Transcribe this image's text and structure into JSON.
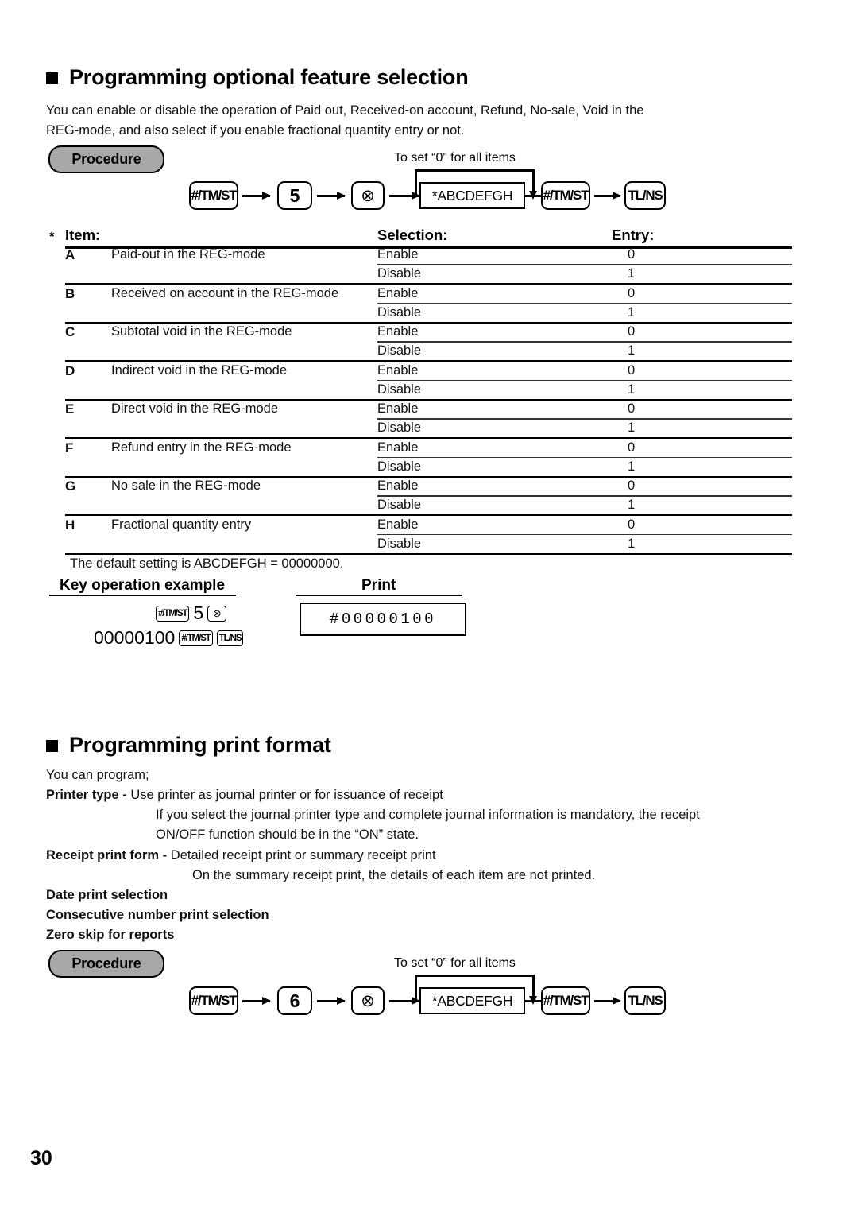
{
  "page": {
    "number": "30"
  },
  "section1": {
    "heading": "Programming optional feature selection",
    "intro_line1": "You can enable or disable the operation of Paid out, Received-on account, Refund, No-sale, Void in the",
    "intro_line2": "REG-mode, and also select if you enable fractional quantity entry or not.",
    "procedure_label": "Procedure",
    "flow": {
      "caption": "To set “0” for all items",
      "key1": "#/TM/ST",
      "key2": "5",
      "key3": "⊗",
      "box": "*ABCDEFGH",
      "key4": "#/TM/ST",
      "key5": "TL/NS"
    },
    "table": {
      "star": "*",
      "header_item": "Item:",
      "header_selection": "Selection:",
      "header_entry": "Entry:",
      "rows": [
        {
          "letter": "A",
          "item": "Paid-out in the REG-mode",
          "options": [
            {
              "selection": "Enable",
              "entry": "0"
            },
            {
              "selection": "Disable",
              "entry": "1"
            }
          ]
        },
        {
          "letter": "B",
          "item": "Received on account in the REG-mode",
          "options": [
            {
              "selection": "Enable",
              "entry": "0"
            },
            {
              "selection": "Disable",
              "entry": "1"
            }
          ]
        },
        {
          "letter": "C",
          "item": "Subtotal void in the REG-mode",
          "options": [
            {
              "selection": "Enable",
              "entry": "0"
            },
            {
              "selection": "Disable",
              "entry": "1"
            }
          ]
        },
        {
          "letter": "D",
          "item": "Indirect void in the REG-mode",
          "options": [
            {
              "selection": "Enable",
              "entry": "0"
            },
            {
              "selection": "Disable",
              "entry": "1"
            }
          ]
        },
        {
          "letter": "E",
          "item": "Direct void in the REG-mode",
          "options": [
            {
              "selection": "Enable",
              "entry": "0"
            },
            {
              "selection": "Disable",
              "entry": "1"
            }
          ]
        },
        {
          "letter": "F",
          "item": "Refund entry in the REG-mode",
          "options": [
            {
              "selection": "Enable",
              "entry": "0"
            },
            {
              "selection": "Disable",
              "entry": "1"
            }
          ]
        },
        {
          "letter": "G",
          "item": "No sale in the REG-mode",
          "options": [
            {
              "selection": "Enable",
              "entry": "0"
            },
            {
              "selection": "Disable",
              "entry": "1"
            }
          ]
        },
        {
          "letter": "H",
          "item": "Fractional quantity entry",
          "options": [
            {
              "selection": "Enable",
              "entry": "0"
            },
            {
              "selection": "Disable",
              "entry": "1"
            }
          ]
        }
      ]
    },
    "default_note": "The default setting is ABCDEFGH = 00000000.",
    "example": {
      "heading_keyop": "Key operation example",
      "heading_print": "Print",
      "line1_key1": "#/TM/ST",
      "line1_num": "5",
      "line1_key2": "⊗",
      "line2_num": "00000100",
      "line2_key1": "#/TM/ST",
      "line2_key2": "TL/NS",
      "print_value": "#00000100"
    }
  },
  "section2": {
    "heading": "Programming print format",
    "intro": "You can program;",
    "printer_type_label": "Printer type -",
    "printer_type_text": "Use printer as journal printer or for issuance of receipt",
    "printer_type_note1": "If you select the journal printer type and complete journal information is mandatory, the receipt",
    "printer_type_note2": "ON/OFF function should be in the “ON” state.",
    "receipt_form_label": "Receipt print form -",
    "receipt_form_text": "Detailed receipt print or summary receipt print",
    "receipt_form_note": "On the summary receipt print, the details of each item are not printed.",
    "bold_item1": "Date print selection",
    "bold_item2": "Consecutive number print selection",
    "bold_item3": "Zero skip for reports",
    "procedure_label": "Procedure",
    "flow": {
      "caption": "To set “0” for all items",
      "key1": "#/TM/ST",
      "key2": "6",
      "key3": "⊗",
      "box": "*ABCDEFGH",
      "key4": "#/TM/ST",
      "key5": "TL/NS"
    }
  }
}
